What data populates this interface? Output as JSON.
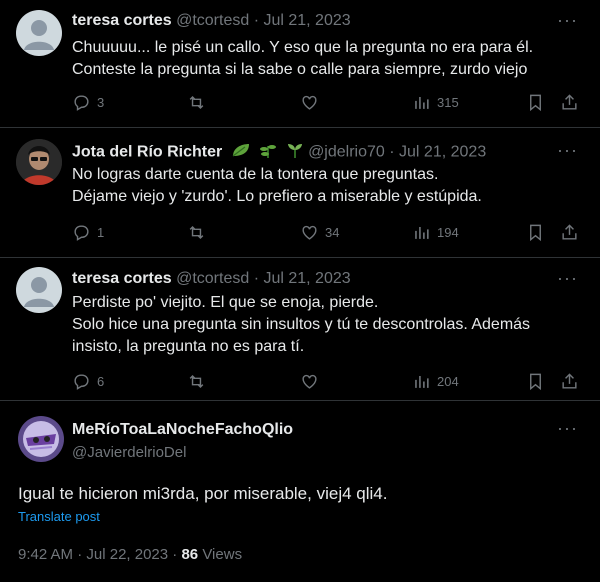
{
  "posts": [
    {
      "name": "teresa cortes",
      "handle": "@tcortesd",
      "dot": "·",
      "date": "Jul 21, 2023",
      "text": "Chuuuuu... le pisé un callo. Y eso que la pregunta no era para él.\nConteste la pregunta si la sabe o calle para siempre, zurdo viejo",
      "replies": "3",
      "reposts": "",
      "likes": "",
      "views": "315"
    },
    {
      "name": "Jota del Río Richter",
      "name_emoji": [
        "leaf-icon",
        "herb-icon",
        "seedling-icon"
      ],
      "handle": "@jdelrio70",
      "dot": "·",
      "date": "Jul 21, 2023",
      "text": "No logras darte cuenta de la tontera que preguntas.\nDéjame viejo y 'zurdo'. Lo prefiero a miserable y estúpida.",
      "replies": "1",
      "reposts": "",
      "likes": "34",
      "views": "194"
    },
    {
      "name": "teresa cortes",
      "handle": "@tcortesd",
      "dot": "·",
      "date": "Jul 21, 2023",
      "text": "Perdiste po' viejito. El que se enoja, pierde.\nSolo hice una pregunta sin insultos y tú te descontrolas. Además insisto, la pregunta no es para tí.",
      "replies": "6",
      "reposts": "",
      "likes": "",
      "views": "204"
    }
  ],
  "main_post": {
    "name": "MeRíoToaLaNocheFachoQlio",
    "handle": "@JavierdelrioDel",
    "text": "Igual te hicieron mi3rda, por miserable, viej4 qli4.",
    "translate": "Translate post",
    "time": "9:42 AM",
    "dot": "·",
    "date": "Jul 22, 2023",
    "dot2": "·",
    "views_count": "86",
    "views_label": "Views",
    "more": "···"
  },
  "icons": {
    "reply": "reply-icon",
    "repost": "repost-icon",
    "like": "like-icon",
    "views": "views-icon",
    "bookmark": "bookmark-icon",
    "share": "share-icon",
    "more": "more-icon"
  },
  "colors": {
    "background": "#000000",
    "text": "#e7e9ea",
    "muted": "#71767b",
    "link": "#1d9bf0",
    "divider": "#2f3336"
  }
}
